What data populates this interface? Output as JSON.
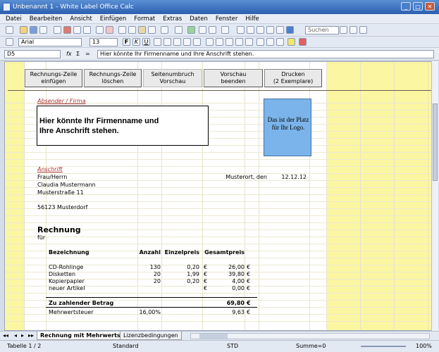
{
  "window": {
    "title": "Unbenannt 1 - White Label Office Calc"
  },
  "menu": [
    "Datei",
    "Bearbeiten",
    "Ansicht",
    "Einfügen",
    "Format",
    "Extras",
    "Daten",
    "Fenster",
    "Hilfe"
  ],
  "toolbar": {
    "search_placeholder": "Suchen",
    "font_name": "Arial",
    "font_size": "13"
  },
  "formula": {
    "cell_ref": "D5",
    "content": "Hier könnte Ihr Firmenname und  Ihre Anschrift stehen."
  },
  "buttons": [
    {
      "line1": "Rechnungs-Zeile",
      "line2": "einfügen"
    },
    {
      "line1": "Rechnungs-Zeile",
      "line2": "löschen"
    },
    {
      "line1": "Seitenumbruch",
      "line2": "Vorschau"
    },
    {
      "line1": "Vorschau",
      "line2": "beenden"
    },
    {
      "line1": "Drucken",
      "line2": "(2 Exemplare)"
    }
  ],
  "sender": {
    "label": "Absender / Firma",
    "company": "Hier könnte Ihr Firmenname und Ihre Anschrift stehen.",
    "logo": "Das ist der Platz für Ihr Logo."
  },
  "address": {
    "label": "Anschrift",
    "salutation": "Frau/Herrn",
    "name": "Claudia Mustermann",
    "street": "Musterstraße 11",
    "city": "56123 Musterdorf",
    "place_date_label": "Musterort, den",
    "date": "12.12.12"
  },
  "invoice": {
    "title": "Rechnung",
    "for_label": "für",
    "headers": {
      "desc": "Bezeichnung",
      "qty": "Anzahl",
      "unit": "Einzelpreis",
      "total": "Gesamtpreis"
    },
    "rows": [
      {
        "desc": "CD-Rohlinge",
        "qty": "130",
        "unit": "0,20",
        "cur1": "€",
        "total": "26,00",
        "cur2": "€"
      },
      {
        "desc": "Disketten",
        "qty": "20",
        "unit": "1,99",
        "cur1": "€",
        "total": "39,80",
        "cur2": "€"
      },
      {
        "desc": "Kopierpapier",
        "qty": "20",
        "unit": "0,20",
        "cur1": "€",
        "total": "4,00",
        "cur2": "€"
      },
      {
        "desc": "neuer Artikel",
        "qty": "",
        "unit": "",
        "cur1": "€",
        "total": "0,00",
        "cur2": "€"
      }
    ],
    "sum_label": "Zu zahlender Betrag",
    "sum_value": "69,80",
    "sum_cur": "€",
    "tax_label": "Mehrwertsteuer",
    "tax_rate": "16,00%",
    "tax_value": "9,63",
    "tax_cur": "€"
  },
  "sheet_tabs": [
    "Rechnung mit Mehrwertsteuer",
    "Lizenzbedingungen"
  ],
  "status": {
    "sheet": "Tabelle 1 / 2",
    "style": "Standard",
    "mode": "STD",
    "sum": "Summe=0",
    "zoom": "100%"
  }
}
